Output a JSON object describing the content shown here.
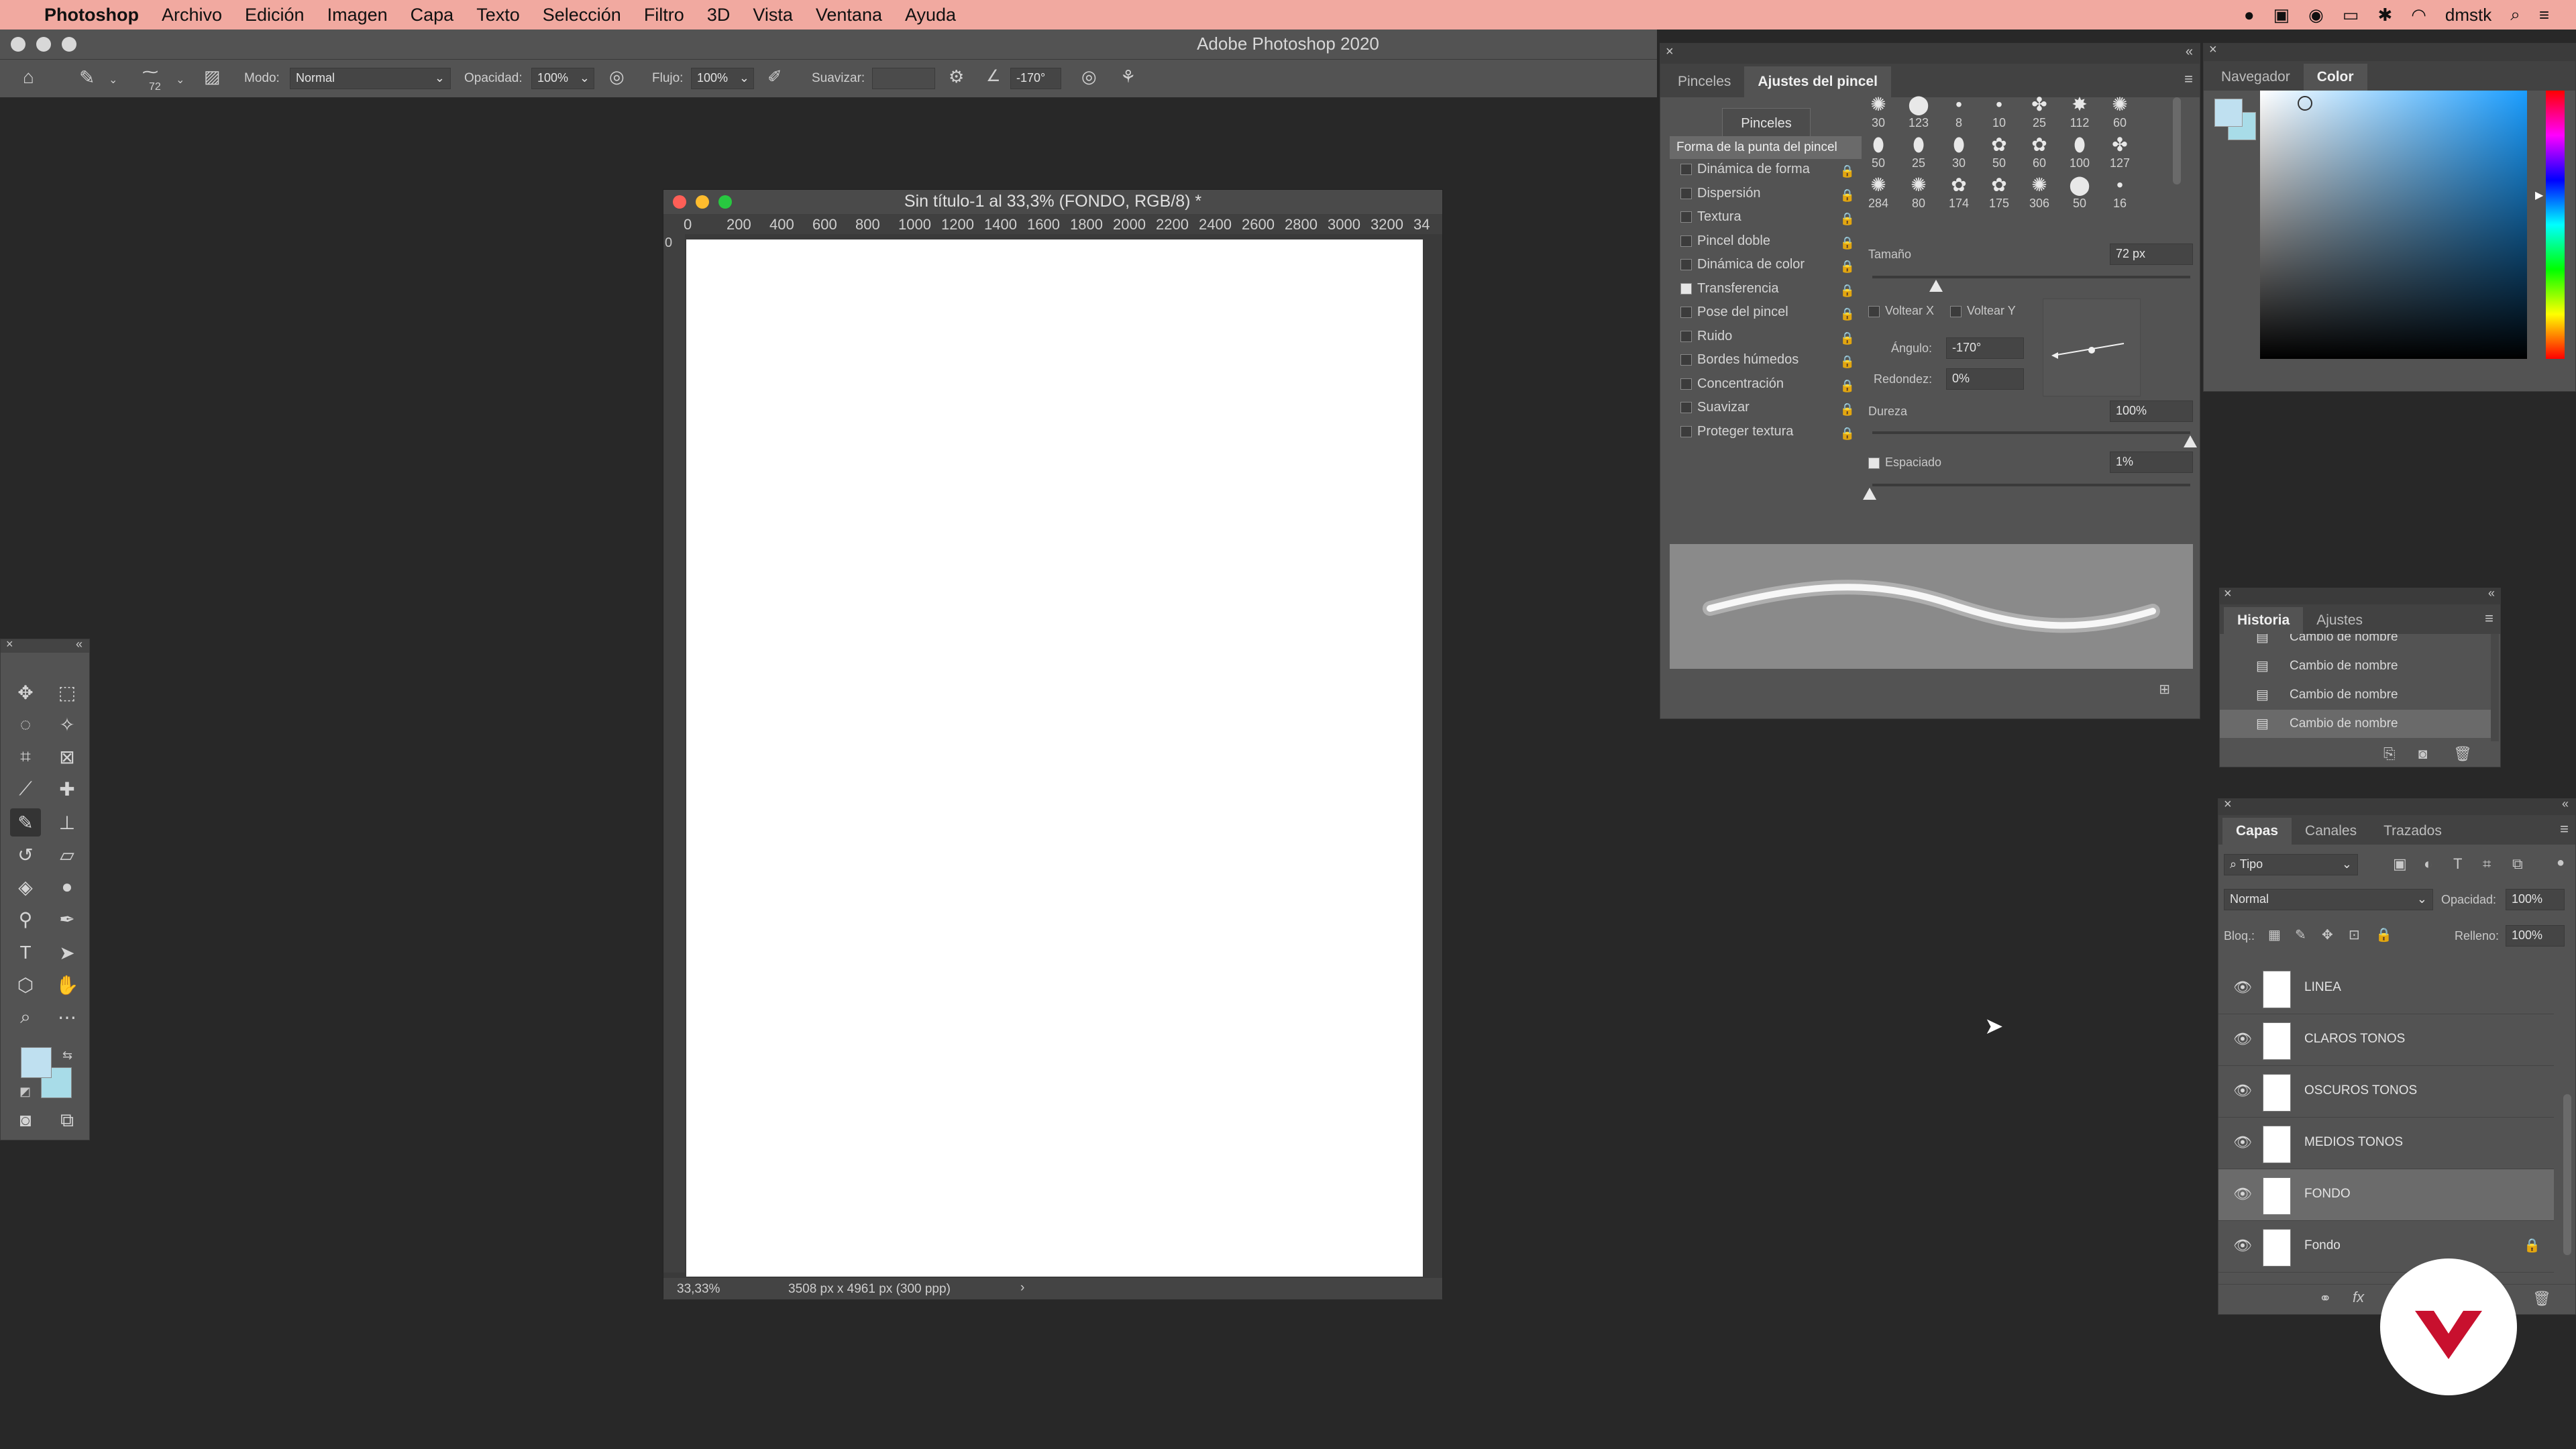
{
  "menubar": {
    "app": "Photoshop",
    "items": [
      "Archivo",
      "Edición",
      "Imagen",
      "Capa",
      "Texto",
      "Selección",
      "Filtro",
      "3D",
      "Vista",
      "Ventana",
      "Ayuda"
    ],
    "user": "dmstk"
  },
  "window": {
    "title": "Adobe Photoshop 2020"
  },
  "options": {
    "brush_size": "72",
    "mode_label": "Modo:",
    "mode_value": "Normal",
    "opacity_label": "Opacidad:",
    "opacity_value": "100%",
    "flow_label": "Flujo:",
    "flow_value": "100%",
    "smooth_label": "Suavizar:",
    "angle_value": "-170°"
  },
  "document": {
    "title": "Sin título-1 al 33,3% (FONDO, RGB/8) *",
    "ruler_h": [
      "0",
      "200",
      "400",
      "600",
      "800",
      "1000",
      "1200",
      "1400",
      "1600",
      "1800",
      "2000",
      "2200",
      "2400",
      "2600",
      "2800",
      "3000",
      "3200",
      "34"
    ],
    "ruler_v_zero": "0",
    "zoom": "33,33%",
    "size_info": "3508 px x 4961 px (300 ppp)"
  },
  "brush_panel": {
    "tabs": [
      "Pinceles",
      "Ajustes del pincel"
    ],
    "active_tab": 1,
    "pinceles_button": "Pinceles",
    "tip_shape_label": "Forma de la punta del pincel",
    "settings": [
      {
        "label": "Dinámica de forma",
        "checked": false
      },
      {
        "label": "Dispersión",
        "checked": false
      },
      {
        "label": "Textura",
        "checked": false
      },
      {
        "label": "Pincel doble",
        "checked": false
      },
      {
        "label": "Dinámica de color",
        "checked": false
      },
      {
        "label": "Transferencia",
        "checked": true
      },
      {
        "label": "Pose del pincel",
        "checked": false
      },
      {
        "label": "Ruido",
        "checked": false
      },
      {
        "label": "Bordes húmedos",
        "checked": false
      },
      {
        "label": "Concentración",
        "checked": false
      },
      {
        "label": "Suavizar",
        "checked": false
      },
      {
        "label": "Proteger textura",
        "checked": false
      }
    ],
    "tip_sizes": [
      "30",
      "123",
      "8",
      "10",
      "25",
      "112",
      "60",
      "50",
      "25",
      "30",
      "50",
      "60",
      "100",
      "127",
      "284",
      "80",
      "174",
      "175",
      "306",
      "50",
      "16"
    ],
    "size_label": "Tamaño",
    "size_value": "72 px",
    "size_fraction": 0.2,
    "flip_x": "Voltear X",
    "flip_y": "Voltear Y",
    "angle_label": "Ángulo:",
    "angle_value": "-170°",
    "roundness_label": "Redondez:",
    "roundness_value": "0%",
    "hardness_label": "Dureza",
    "hardness_value": "100%",
    "spacing_label": "Espaciado",
    "spacing_value": "1%"
  },
  "color_panel": {
    "tabs": [
      "Navegador",
      "Color"
    ],
    "active_tab": 1,
    "fg_color": "#bfe0f0",
    "bg_color": "#a8dce8"
  },
  "history_panel": {
    "tabs": [
      "Historia",
      "Ajustes"
    ],
    "items": [
      "Cambio de nombre",
      "Cambio de nombre",
      "Cambio de nombre",
      "Cambio de nombre"
    ],
    "selected_index": 3
  },
  "layers_panel": {
    "tabs": [
      "Capas",
      "Canales",
      "Trazados"
    ],
    "filter_label": "Tipo",
    "blend_mode": "Normal",
    "opacity_label": "Opacidad:",
    "opacity_value": "100%",
    "lock_label": "Bloq.:",
    "fill_label": "Relleno:",
    "fill_value": "100%",
    "layers": [
      {
        "name": "LINEA",
        "locked": false
      },
      {
        "name": "CLAROS TONOS",
        "locked": false
      },
      {
        "name": "OSCUROS TONOS",
        "locked": false
      },
      {
        "name": "MEDIOS TONOS",
        "locked": false
      },
      {
        "name": "FONDO",
        "locked": false
      },
      {
        "name": "Fondo",
        "locked": true
      }
    ],
    "selected_index": 4,
    "footer_fx": "fx"
  },
  "colors": {
    "accent": "#c8102e"
  }
}
